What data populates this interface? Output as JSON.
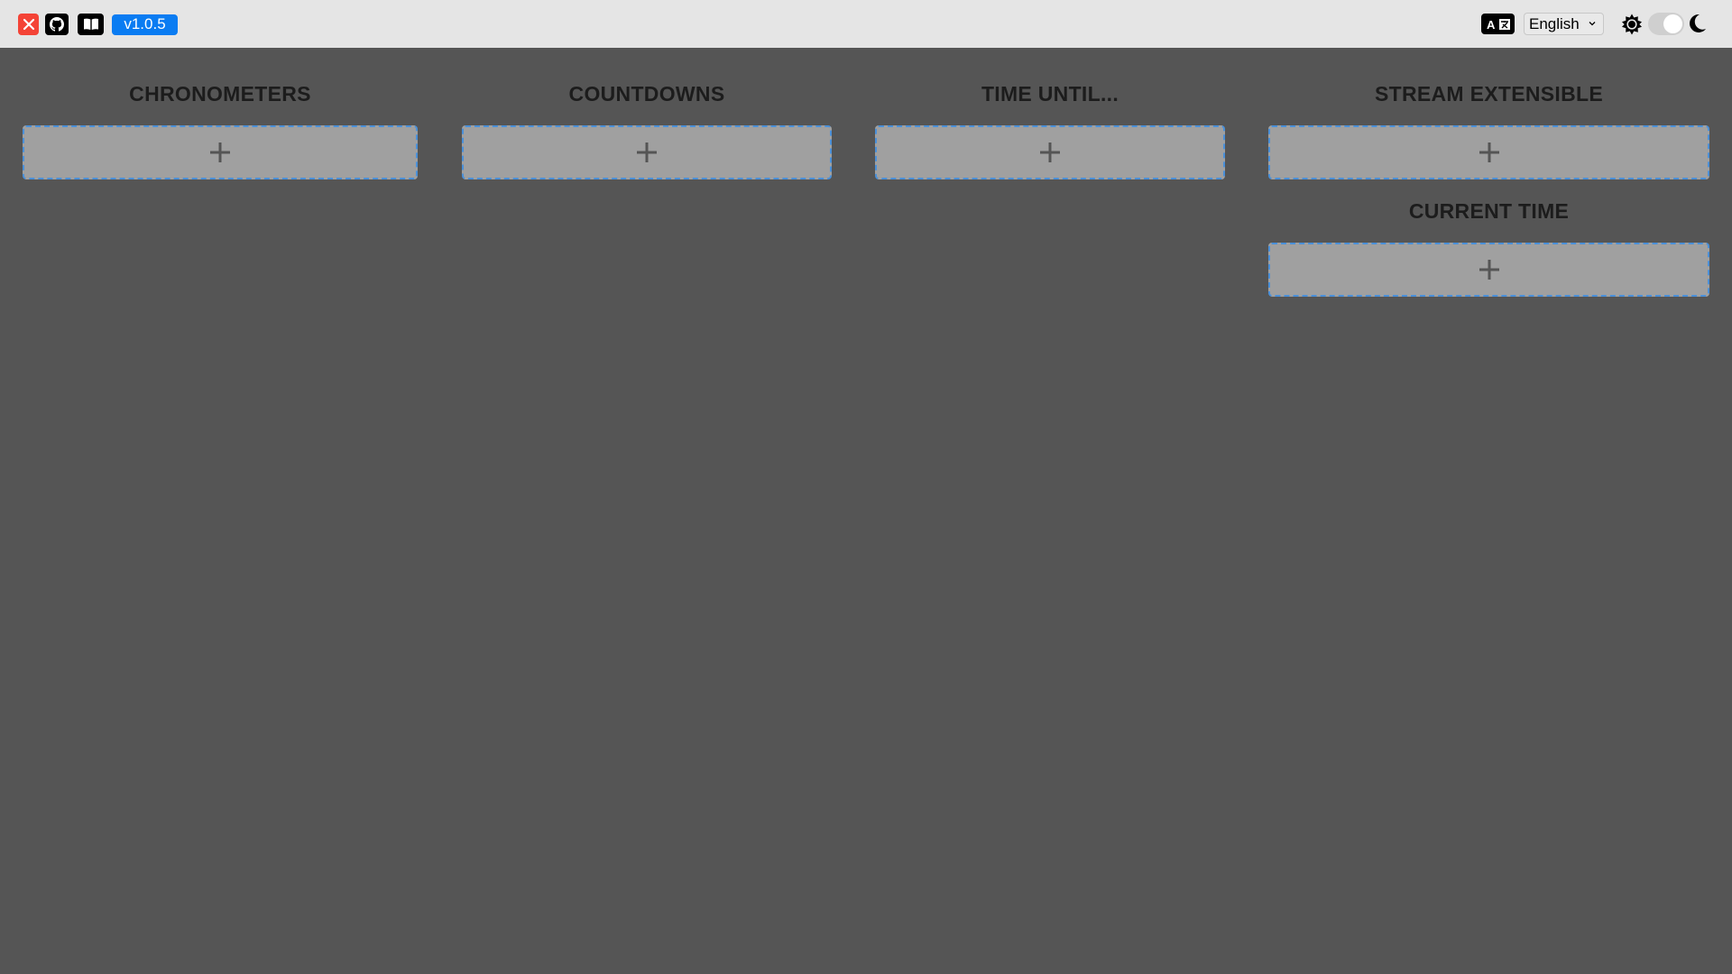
{
  "header": {
    "close_icon": "close-icon",
    "github_icon": "github-icon",
    "docs_icon": "book-icon",
    "version": "v1.0.5",
    "translate_icon": "translate-icon",
    "language": {
      "selected": "English"
    },
    "theme": {
      "light_icon": "sun-icon",
      "dark_icon": "moon-icon",
      "dark_mode": true
    }
  },
  "sections": [
    {
      "title": "CHRONOMETERS",
      "add_icon": "plus-icon"
    },
    {
      "title": "COUNTDOWNS",
      "add_icon": "plus-icon"
    },
    {
      "title": "TIME UNTIL...",
      "add_icon": "plus-icon"
    },
    {
      "title": "STREAM EXTENSIBLE",
      "add_icon": "plus-icon"
    },
    {
      "title": "CURRENT TIME",
      "add_icon": "plus-icon"
    }
  ],
  "colors": {
    "header_bg": "#e5e5e5",
    "page_bg": "#555555",
    "close_red": "#f44336",
    "version_blue": "#0a7cf2",
    "dashed_border": "#4a90d9",
    "box_bg": "#a0a0a0"
  }
}
